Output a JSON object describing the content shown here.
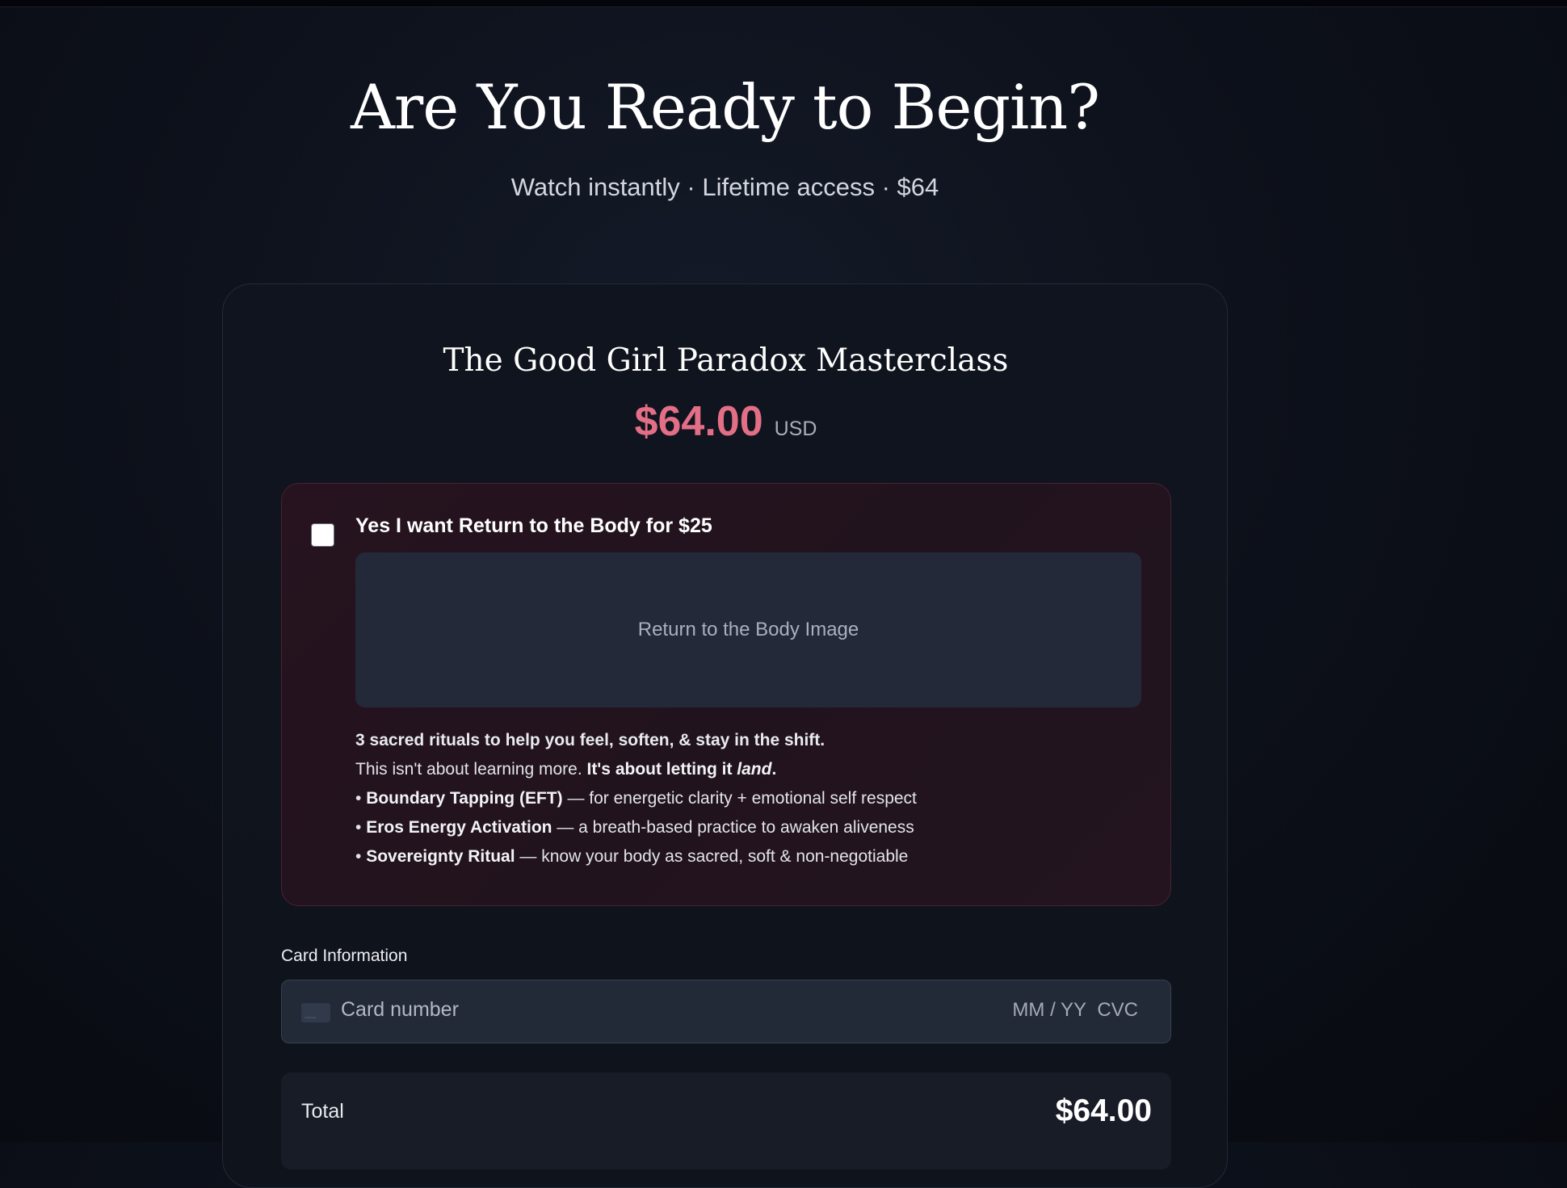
{
  "hero": {
    "title": "Are You Ready to Begin?",
    "subtitle": "Watch instantly · Lifetime access · $64"
  },
  "product": {
    "title": "The Good Girl Paradox Masterclass",
    "price": "$64.00",
    "currency": "USD",
    "accent_color": "#e36f86"
  },
  "upsell": {
    "checked": false,
    "label": "Yes I want Return to the Body for $25",
    "image_placeholder": "Return to the Body Image",
    "headline": "3 sacred rituals to help you feel, soften, & stay in the shift.",
    "intro_plain": "This isn't about learning more. ",
    "intro_bold": "It's about letting it ",
    "intro_italic": "land",
    "intro_end": ".",
    "bullets": [
      {
        "name": "Boundary Tapping (EFT)",
        "desc": " — for energetic clarity + emotional self respect"
      },
      {
        "name": "Eros Energy Activation",
        "desc": " — a breath-based practice to awaken aliveness"
      },
      {
        "name": "Sovereignty Ritual",
        "desc": " — know your body as sacred, soft & non-negotiable"
      }
    ]
  },
  "payment": {
    "card_label": "Card Information",
    "card_number_placeholder": "Card number",
    "expiry_placeholder": "MM / YY",
    "cvc_placeholder": "CVC",
    "card_icon": "credit-card-icon"
  },
  "total": {
    "label": "Total",
    "value": "$64.00"
  }
}
